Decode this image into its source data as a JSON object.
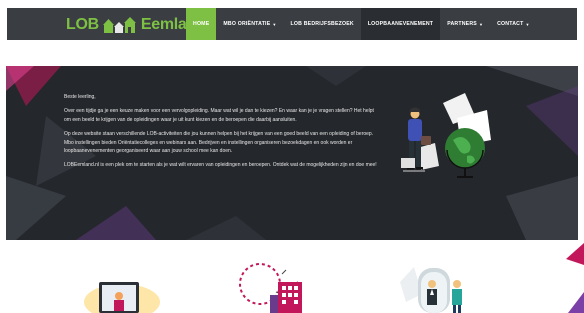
{
  "logo": {
    "text_left": "LOB",
    "text_right": "Eemland"
  },
  "nav": {
    "items": [
      {
        "label": "Home",
        "caret": ""
      },
      {
        "label": "MBO Oriëntatie",
        "caret": "▼"
      },
      {
        "label": "LOB Bedrijfsbezoek",
        "caret": ""
      },
      {
        "label": "Loopbaanevenement",
        "caret": ""
      },
      {
        "label": "Partners",
        "caret": "▼"
      },
      {
        "label": "Contact",
        "caret": "▼"
      }
    ]
  },
  "hero": {
    "greeting": "Beste leerling,",
    "paragraph1": "Over een tijdje ga je een keuze maken voor een vervolgopleiding. Maar wat wil je dan te kiezen? En waar kan je je vragen stellen? Het helpt om een beeld te krijgen van de opleidingen waar je uit kunt kiezen en de beroepen die daarbij aansluiten.",
    "paragraph2": "Op deze website staan verschillende LOB-activiteiten die jou kunnen helpen bij het krijgen van een goed beeld van een opleiding of beroep. Mbo instellingen bieden Oriëntatiecolleges en webinars aan. Bedrijven en instellingen organiseren bezoekdagen en ook worden er loopbaanevenementen georganiseerd waar aan jouw school mee kan doen.",
    "paragraph3": "LOBEemland.nl is een plek om te starten als je wat wilt ervaren van opleidingen en beroepen. Ontdek wat de mogelijkheden zijn en doe mee!"
  },
  "colors": {
    "accent": "#7ec043",
    "navbar": "#3a3d42",
    "hero_bg": "#24272c",
    "magenta": "#c2185b",
    "purple": "#6a3b8c"
  },
  "icons": [
    "house-logo-icon",
    "person-globe-illustration",
    "computer-illustration",
    "building-illustration",
    "mirror-people-illustration"
  ]
}
